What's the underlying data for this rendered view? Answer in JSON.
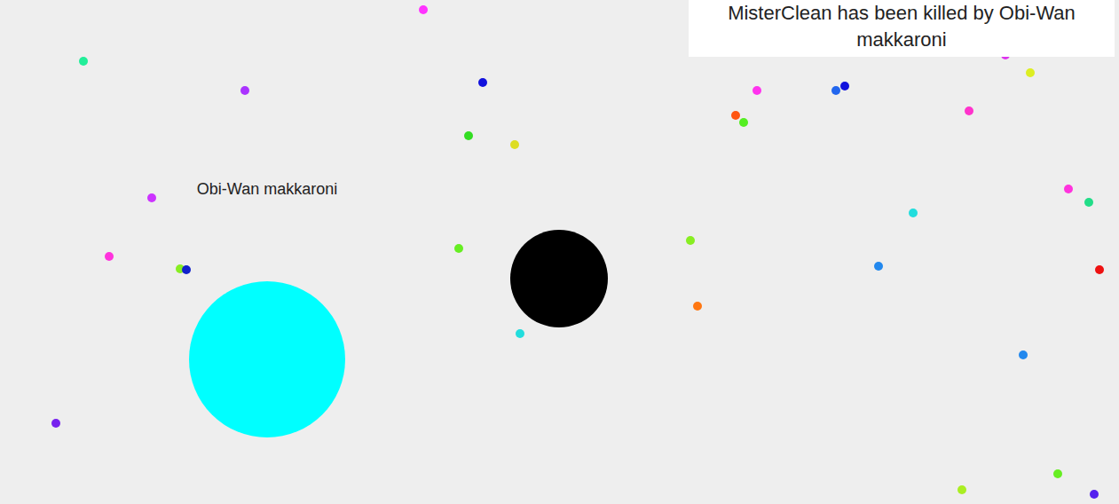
{
  "notification": {
    "text": "MisterClean has been killed by Obi-Wan makkaroni"
  },
  "cells": [
    {
      "name": "Obi-Wan makkaroni",
      "color": "#00ffff"
    },
    {
      "color": "#000000"
    }
  ],
  "pellets": [
    {
      "color": "#ff33ff"
    },
    {
      "color": "#22ee99"
    },
    {
      "color": "#aa33ff"
    },
    {
      "color": "#1111dd"
    },
    {
      "color": "#33dd22"
    },
    {
      "color": "#dddd22"
    },
    {
      "color": "#ff33ee"
    },
    {
      "color": "#ff5511"
    },
    {
      "color": "#55ee22"
    },
    {
      "color": "#2266ee"
    },
    {
      "color": "#1111dd"
    },
    {
      "color": "#dd33ee"
    },
    {
      "color": "#ddee22"
    },
    {
      "color": "#ff33cc"
    },
    {
      "color": "#ff33dd"
    },
    {
      "color": "#22dd88"
    },
    {
      "color": "#22dddd"
    },
    {
      "color": "#cc33ff"
    },
    {
      "color": "#ff33dd"
    },
    {
      "color": "#66ee22"
    },
    {
      "color": "#88ee22"
    },
    {
      "color": "#1122cc"
    },
    {
      "color": "#88ee22"
    },
    {
      "color": "#2288ee"
    },
    {
      "color": "#ee1111"
    },
    {
      "color": "#ff7711"
    },
    {
      "color": "#22dddd"
    },
    {
      "color": "#2288ee"
    },
    {
      "color": "#7722ee"
    },
    {
      "color": "#66ee22"
    },
    {
      "color": "#aaee22"
    },
    {
      "color": "#5522ee"
    }
  ]
}
